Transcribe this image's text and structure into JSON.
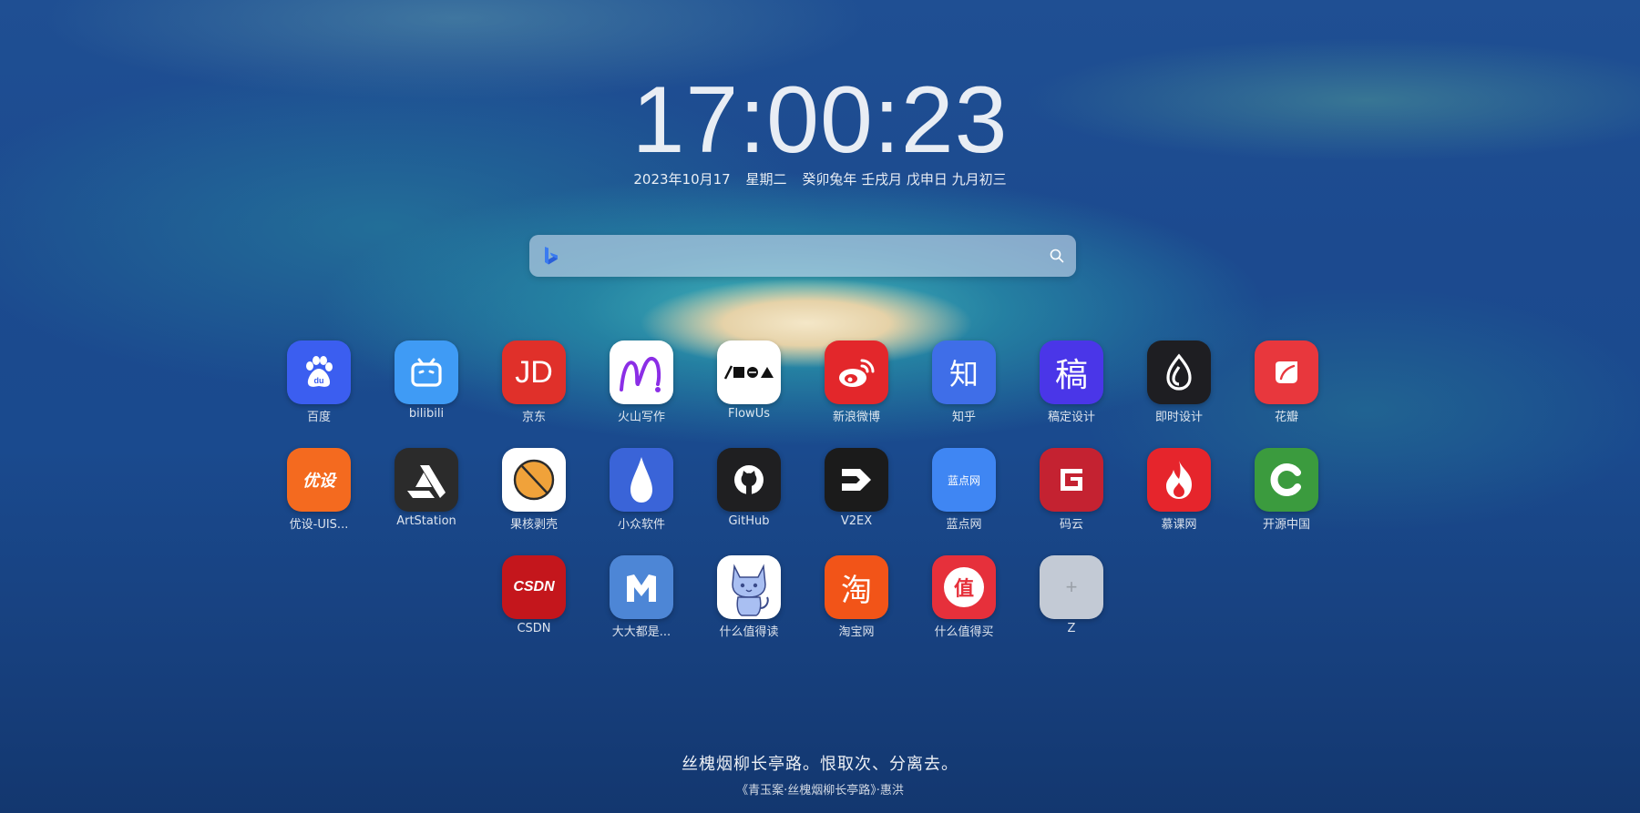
{
  "clock": {
    "time": "17:00:23"
  },
  "date": {
    "gregorian": "2023年10月17",
    "weekday": "星期二",
    "lunar": "癸卯兔年 壬戌月 戊申日 九月初三"
  },
  "search": {
    "placeholder": "",
    "value": "",
    "engine_icon": "bing-icon"
  },
  "apps": [
    {
      "label": "百度",
      "icon": "baidu-paw-icon",
      "color": "#3b5ef0"
    },
    {
      "label": "bilibili",
      "icon": "bilibili-tv-icon",
      "color": "#3f9bf5"
    },
    {
      "label": "京东",
      "icon": "jd-icon",
      "color": "#e0302a"
    },
    {
      "label": "火山写作",
      "icon": "huoshan-write-icon",
      "color": "#ffffff"
    },
    {
      "label": "FlowUs",
      "icon": "flowus-icon",
      "color": "#ffffff"
    },
    {
      "label": "新浪微博",
      "icon": "weibo-icon",
      "color": "#e3272b"
    },
    {
      "label": "知乎",
      "icon": "zhihu-icon",
      "color": "#3f6ee8"
    },
    {
      "label": "稿定设计",
      "icon": "gaoding-icon",
      "color": "#4a36e8"
    },
    {
      "label": "即时设计",
      "icon": "jishi-design-icon",
      "color": "#1e1e22"
    },
    {
      "label": "花瓣",
      "icon": "huaban-icon",
      "color": "#e8373d"
    },
    {
      "label": "优设-UIS...",
      "icon": "uisdc-icon",
      "color": "#f46a1f"
    },
    {
      "label": "ArtStation",
      "icon": "artstation-icon",
      "color": "#2b2b2b"
    },
    {
      "label": "果核剥壳",
      "icon": "guohe-icon",
      "color": "#ffffff"
    },
    {
      "label": "小众软件",
      "icon": "drop-icon",
      "color": "#3a64d8"
    },
    {
      "label": "GitHub",
      "icon": "github-icon",
      "color": "#1f1f21"
    },
    {
      "label": "V2EX",
      "icon": "v2ex-icon",
      "color": "#1b1b1b"
    },
    {
      "label": "蓝点网",
      "icon": "landian-icon",
      "color": "#3f86f3"
    },
    {
      "label": "码云",
      "icon": "gitee-icon",
      "color": "#c42231"
    },
    {
      "label": "慕课网",
      "icon": "flame-icon",
      "color": "#e6252c"
    },
    {
      "label": "开源中国",
      "icon": "oschina-icon",
      "color": "#3b9b3e"
    },
    {
      "label": "CSDN",
      "icon": "csdn-icon",
      "color": "#c4161c"
    },
    {
      "label": "大大都是...",
      "icon": "m-logo-icon",
      "color": "#4d86d6"
    },
    {
      "label": "什么值得读",
      "icon": "cat-icon",
      "color": "#ffffff"
    },
    {
      "label": "淘宝网",
      "icon": "taobao-icon",
      "color": "#f25418"
    },
    {
      "label": "什么值得买",
      "icon": "smzdm-icon",
      "color": "#e6303b"
    },
    {
      "label": "Z",
      "icon": "plus-icon",
      "color": "#d6d9de"
    }
  ],
  "tile_text": {
    "jd": "JD",
    "zhihu": "知",
    "gaoding": "稿",
    "uisdc": "优设",
    "csdn": "CSDN",
    "taobao": "淘",
    "smzdm": "值",
    "landian": "蓝点网",
    "plus": "+"
  },
  "quote": {
    "text": "丝槐烟柳长亭路。恨取次、分离去。",
    "source": "《青玉案·丝槐烟柳长亭路》·惠洪"
  }
}
